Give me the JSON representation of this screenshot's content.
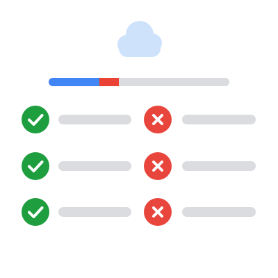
{
  "colors": {
    "pass": "#1e9e3e",
    "fail": "#e8453c",
    "progress_done": "#4285f4",
    "progress_failed": "#ea4335",
    "track": "#dadce0",
    "cloud": "#cfe2fc"
  },
  "header": {
    "icon": "cloud-icon"
  },
  "progress": {
    "segments": [
      {
        "name": "passed",
        "fraction": 0.28,
        "color": "#4285f4"
      },
      {
        "name": "failed",
        "fraction": 0.11,
        "color": "#ea4335"
      }
    ]
  },
  "rows": [
    {
      "left_status": "pass",
      "right_status": "fail"
    },
    {
      "left_status": "pass",
      "right_status": "fail"
    },
    {
      "left_status": "pass",
      "right_status": "fail"
    }
  ],
  "icons": {
    "pass": "check-circle-icon",
    "fail": "x-circle-icon"
  }
}
